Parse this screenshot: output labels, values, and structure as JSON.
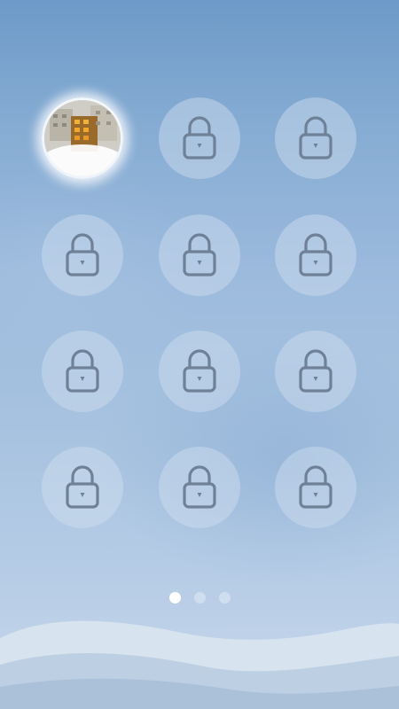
{
  "grid": {
    "tiles": [
      {
        "type": "photo",
        "icon": "photo-thumbnail"
      },
      {
        "type": "lock",
        "icon": "padlock-icon"
      },
      {
        "type": "lock",
        "icon": "padlock-icon"
      },
      {
        "type": "lock",
        "icon": "padlock-icon"
      },
      {
        "type": "lock",
        "icon": "padlock-icon"
      },
      {
        "type": "lock",
        "icon": "padlock-icon"
      },
      {
        "type": "lock",
        "icon": "padlock-icon"
      },
      {
        "type": "lock",
        "icon": "padlock-icon"
      },
      {
        "type": "lock",
        "icon": "padlock-icon"
      },
      {
        "type": "lock",
        "icon": "padlock-icon"
      },
      {
        "type": "lock",
        "icon": "padlock-icon"
      },
      {
        "type": "lock",
        "icon": "padlock-icon"
      }
    ]
  },
  "pager": {
    "page_count": 3,
    "current_page": 1
  },
  "colors": {
    "lock_stroke": "#6e8197",
    "tile_fill": "#d2e1f0",
    "active_dot": "#ffffff"
  }
}
